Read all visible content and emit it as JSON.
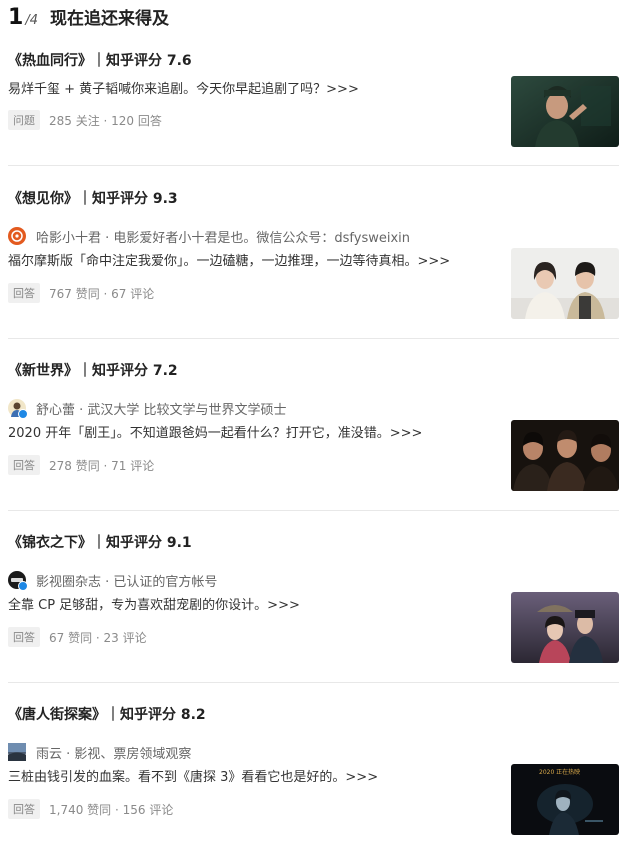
{
  "header": {
    "current": "1",
    "total": "4",
    "title": "现在追还来得及"
  },
  "cards": [
    {
      "title": "《热血同行》｜知乎评分 7.6",
      "excerpt": "易烊千玺 + 黄子韬喊你来追剧。今天你早起追剧了吗？>>>",
      "tag": "问题",
      "stats": "285 关注 · 120 回答"
    },
    {
      "title": "《想见你》｜知乎评分 9.3",
      "author": "哈影小十君 · 电影爱好者小十君是也。微信公众号：dsfysweixin",
      "excerpt": "福尔摩斯版「命中注定我爱你」。一边磕糖，一边推理，一边等待真相。>>>",
      "tag": "回答",
      "stats": "767 赞同 · 67 评论"
    },
    {
      "title": "《新世界》｜知乎评分 7.2",
      "author": "舒心蕾 · 武汉大学 比较文学与世界文学硕士",
      "excerpt": "2020 开年「剧王」。不知道跟爸妈一起看什么？打开它，准没错。>>>",
      "tag": "回答",
      "stats": "278 赞同 · 71 评论"
    },
    {
      "title": "《锦衣之下》｜知乎评分 9.1",
      "author": "影视圈杂志 · 已认证的官方帐号",
      "excerpt": "全靠 CP 足够甜，专为喜欢甜宠剧的你设计。>>>",
      "tag": "回答",
      "stats": "67 赞同 · 23 评论"
    },
    {
      "title": "《唐人街探案》｜知乎评分 8.2",
      "author": "雨云 · 影视、票房领域观察",
      "excerpt": "三桩由钱引发的血案。看不到《唐探 3》看看它也是好的。>>>",
      "tag": "回答",
      "stats": "1,740 赞同 · 156 评论"
    }
  ],
  "thumb5_label": "2020 正在热映"
}
